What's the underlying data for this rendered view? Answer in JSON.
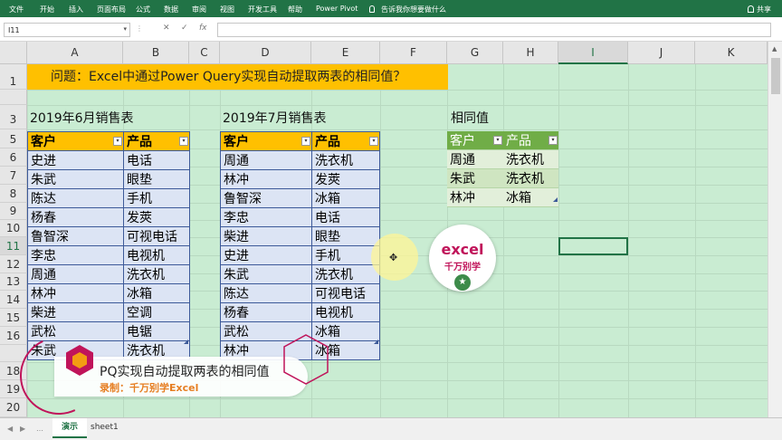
{
  "ribbon": {
    "tabs": [
      "文件",
      "开始",
      "插入",
      "页面布局",
      "公式",
      "数据",
      "审阅",
      "视图",
      "开发工具",
      "帮助",
      "Power Pivot"
    ],
    "tell_me": "告诉我你想要做什么",
    "share": "共享"
  },
  "formula_bar": {
    "name_box": "I11",
    "cancel_icon": "✕",
    "enter_icon": "✓",
    "fx_label": "fx",
    "value": ""
  },
  "columns": [
    "A",
    "B",
    "C",
    "D",
    "E",
    "F",
    "G",
    "H",
    "I",
    "J",
    "K"
  ],
  "selected_column": "I",
  "rows": [
    "1",
    "3",
    "5",
    "6",
    "7",
    "8",
    "9",
    "10",
    "11",
    "12",
    "13",
    "14",
    "15",
    "16",
    "18",
    "19",
    "20"
  ],
  "selected_row": "11",
  "banner": "问题：Excel中通过Power Query实现自动提取两表的相同值？",
  "table1": {
    "title": "2019年6月销售表",
    "headers": [
      "客户",
      "产品"
    ],
    "rows": [
      [
        "史进",
        "电话"
      ],
      [
        "朱武",
        "眼垫"
      ],
      [
        "陈达",
        "手机"
      ],
      [
        "杨春",
        "发莢"
      ],
      [
        "鲁智深",
        "可视电话"
      ],
      [
        "李忠",
        "电视机"
      ],
      [
        "周通",
        "洗衣机"
      ],
      [
        "林冲",
        "冰箱"
      ],
      [
        "柴进",
        "空调"
      ],
      [
        "武松",
        "电锯"
      ],
      [
        "朱武",
        "洗衣机"
      ]
    ]
  },
  "table2": {
    "title": "2019年7月销售表",
    "headers": [
      "客户",
      "产品"
    ],
    "rows": [
      [
        "周通",
        "洗衣机"
      ],
      [
        "林冲",
        "发莢"
      ],
      [
        "鲁智深",
        "冰箱"
      ],
      [
        "李忠",
        "电话"
      ],
      [
        "柴进",
        "眼垫"
      ],
      [
        "史进",
        "手机"
      ],
      [
        "朱武",
        "洗衣机"
      ],
      [
        "陈达",
        "可视电话"
      ],
      [
        "杨春",
        "电视机"
      ],
      [
        "武松",
        "冰箱"
      ],
      [
        "林冲",
        "冰箱"
      ]
    ]
  },
  "table3": {
    "title": "相同值",
    "headers": [
      "客户",
      "产品"
    ],
    "rows": [
      [
        "周通",
        "洗衣机"
      ],
      [
        "朱武",
        "洗衣机"
      ],
      [
        "林冲",
        "冰箱"
      ]
    ]
  },
  "logo": {
    "line1": "excel",
    "line2": "千万别学"
  },
  "caption": {
    "title": "PQ实现自动提取两表的相同值",
    "subtitle": "录制：千万别学Excel"
  },
  "sheet_tabs": [
    "演示",
    "sheet1"
  ],
  "active_sheet": "演示",
  "colors": {
    "ribbon": "#217346",
    "header_fill": "#ffc000",
    "table_body": "#dce4f4",
    "result_header": "#70ad47",
    "grid_bg": "#c9ecd2"
  }
}
